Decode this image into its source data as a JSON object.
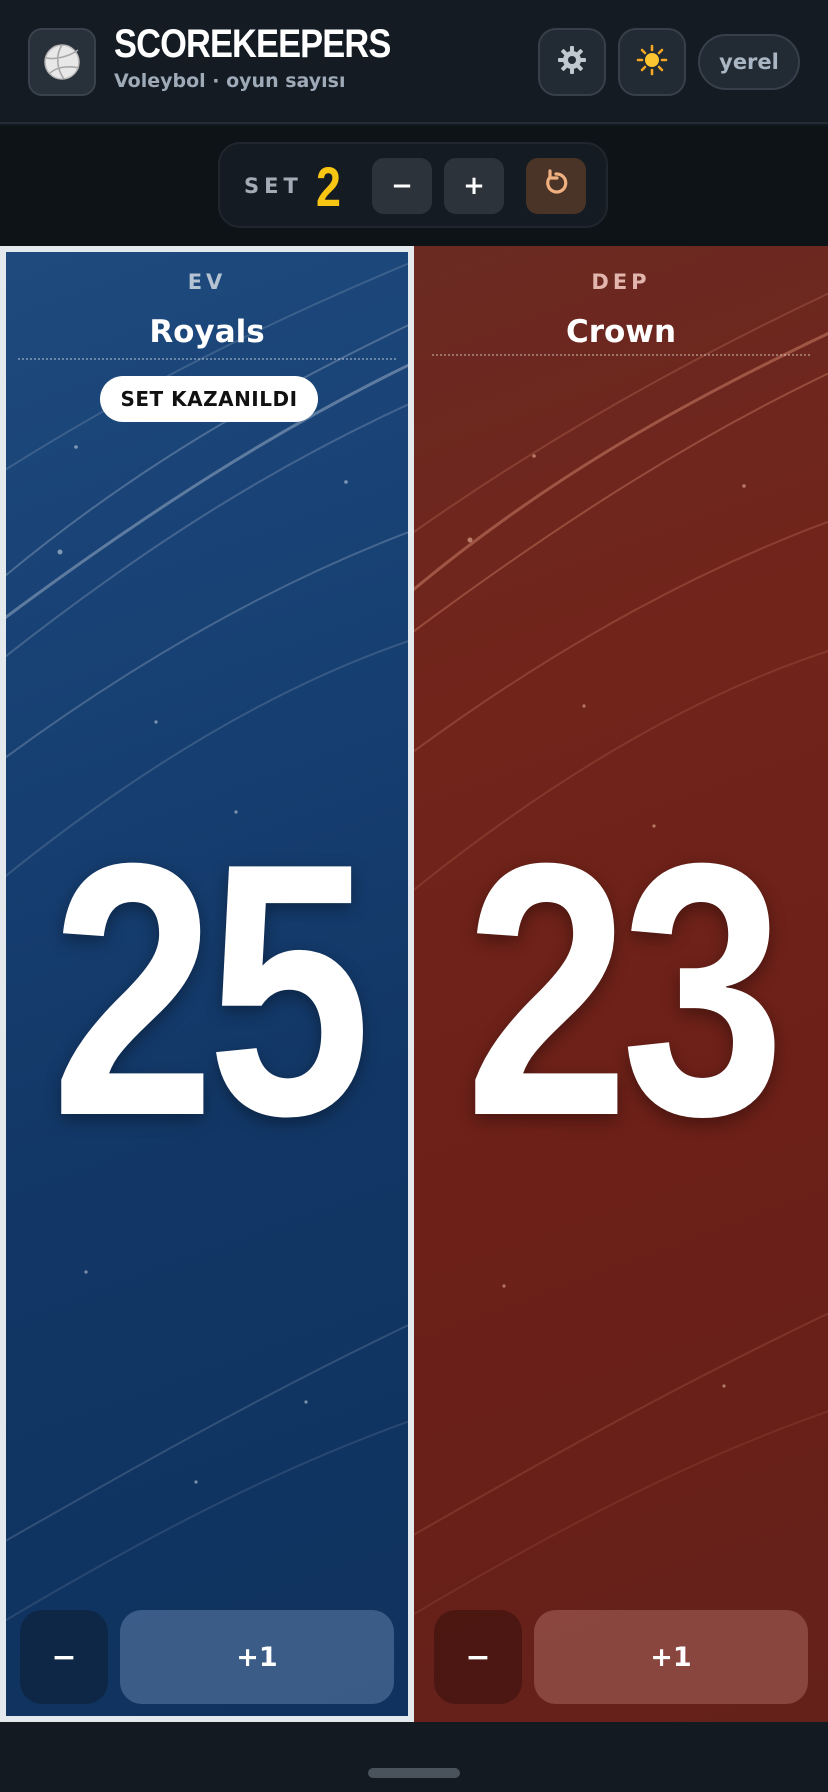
{
  "header": {
    "title": "SCOREKEEPERS",
    "subtitle": "Voleybol · oyun sayısı",
    "logo_icon": "volleyball-icon",
    "settings_icon": "gear-icon",
    "theme_icon": "sun-icon",
    "mode_label": "yerel"
  },
  "set_bar": {
    "label": "SET",
    "number": "2",
    "minus_label": "−",
    "plus_label": "+",
    "reset_icon": "reset-icon",
    "accent_color": "#f7c512"
  },
  "teams": [
    {
      "side": "EV",
      "name": "Royals",
      "badge": "SET KAZANILDI",
      "score": "25",
      "minus_label": "−",
      "plus_label": "+1",
      "color": "#174073"
    },
    {
      "side": "DEP",
      "name": "Crown",
      "score": "23",
      "minus_label": "−",
      "plus_label": "+1",
      "color": "#71241a"
    }
  ]
}
